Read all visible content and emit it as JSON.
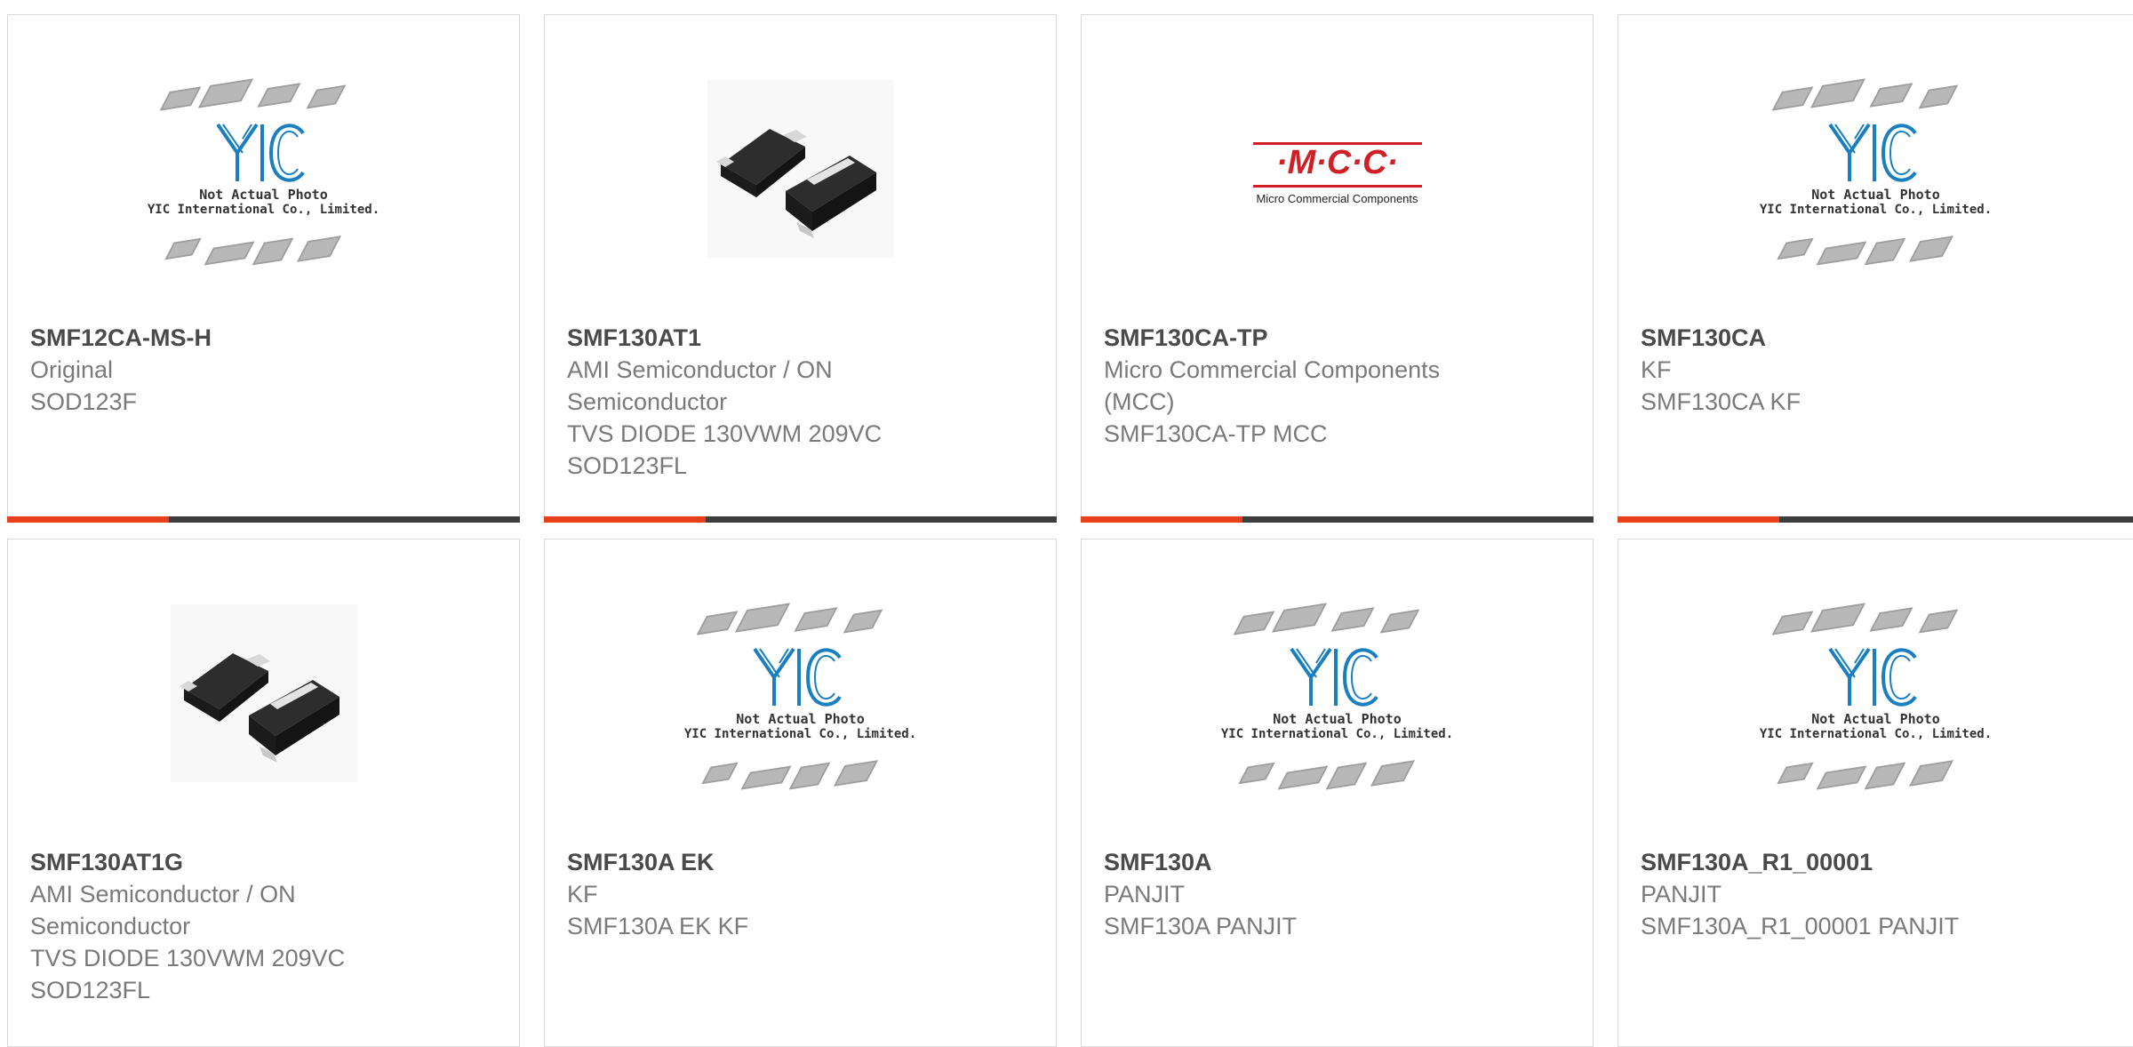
{
  "products": [
    {
      "part": "SMF12CA-MS-H",
      "brand": "Original",
      "desc": "SOD123F",
      "image": "yic-placeholder"
    },
    {
      "part": "SMF130AT1",
      "brand": "AMI Semiconductor / ON\nSemiconductor",
      "desc": "TVS DIODE 130VWM 209VC\nSOD123FL",
      "image": "sod123-package"
    },
    {
      "part": "SMF130CA-TP",
      "brand": "Micro Commercial Components\n(MCC)",
      "desc": "SMF130CA-TP MCC",
      "image": "mcc-logo"
    },
    {
      "part": "SMF130CA",
      "brand": "KF",
      "desc": "SMF130CA KF",
      "image": "yic-placeholder"
    },
    {
      "part": "SMF130AT1G",
      "brand": "AMI Semiconductor / ON\nSemiconductor",
      "desc": "TVS DIODE 130VWM 209VC\nSOD123FL",
      "image": "sod123-package"
    },
    {
      "part": "SMF130A EK",
      "brand": "KF",
      "desc": "SMF130A EK KF",
      "image": "yic-placeholder"
    },
    {
      "part": "SMF130A",
      "brand": "PANJIT",
      "desc": "SMF130A PANJIT",
      "image": "yic-placeholder"
    },
    {
      "part": "SMF130A_R1_00001",
      "brand": "PANJIT",
      "desc": "SMF130A_R1_00001 PANJIT",
      "image": "yic-placeholder"
    }
  ],
  "placeholder": {
    "caption_line1": "Not Actual Photo",
    "caption_line2": "YIC International Co., Limited.",
    "logo_text": "YIC"
  },
  "mcc": {
    "logo_text": "·M·C·C·",
    "tagline": "Micro Commercial Components"
  },
  "colors": {
    "accent": "#e8401b",
    "bar": "#3d3d3d",
    "mcc_red": "#d11f26",
    "yic_blue": "#1a7fc1"
  }
}
